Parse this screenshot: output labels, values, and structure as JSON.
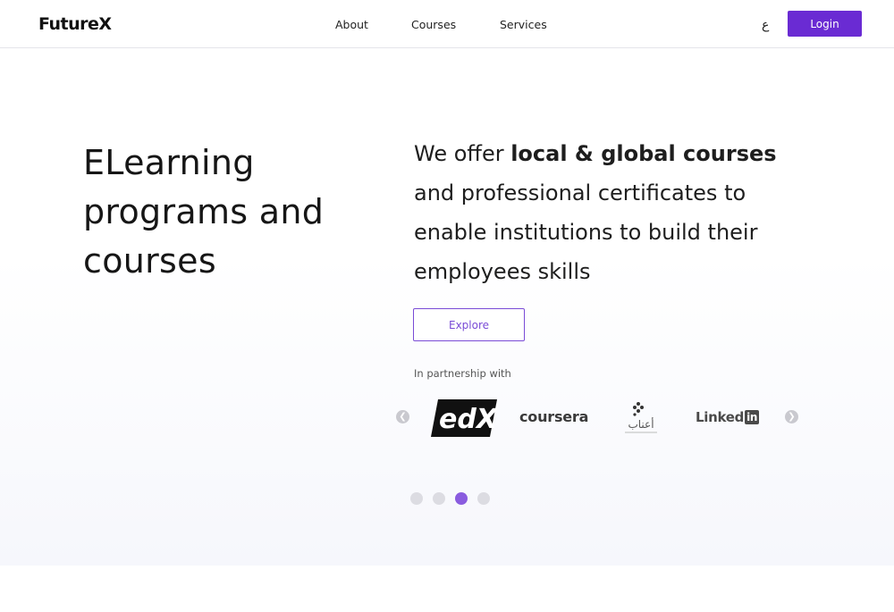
{
  "header": {
    "logo": "FutureX",
    "nav": [
      {
        "label": "About"
      },
      {
        "label": "Courses"
      },
      {
        "label": "Services"
      }
    ],
    "language_toggle": "ع",
    "login_label": "Login"
  },
  "hero": {
    "title": "ELearning programs and courses",
    "description_prefix": "We offer ",
    "description_bold": "local & global courses",
    "description_suffix": " and professional certificates to enable institutions to build their employees skills",
    "explore_label": "Explore",
    "partnership_label": "In partnership with",
    "partners": [
      {
        "name": "edX",
        "text": "edX"
      },
      {
        "name": "coursera",
        "text": "coursera"
      },
      {
        "name": "aanab",
        "text": "أعناب"
      },
      {
        "name": "LinkedIn",
        "text_a": "Linked",
        "text_b": "in"
      }
    ],
    "carousel": {
      "total": 4,
      "active_index": 2
    }
  },
  "colors": {
    "accent": "#6a2bd3",
    "accent_light": "#8a5cdf"
  }
}
